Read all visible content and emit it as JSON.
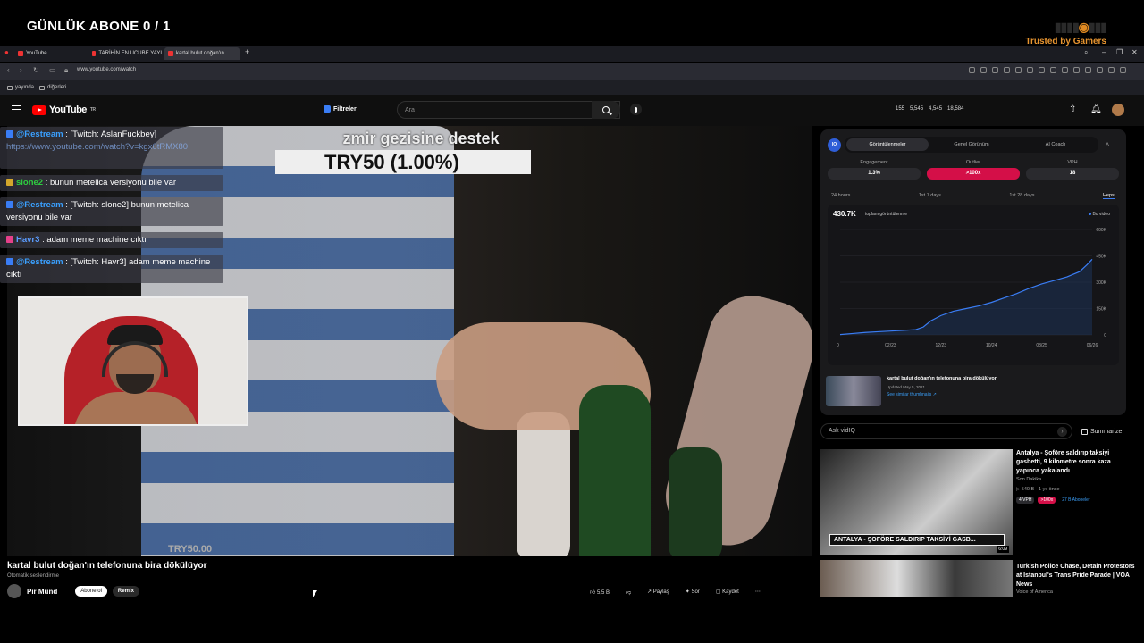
{
  "overlay": {
    "title": "GÜNLÜK ABONE 0 / 1",
    "brand_trust": "Trusted by Gamers"
  },
  "browser": {
    "tabs": [
      {
        "label": "YouTube"
      },
      {
        "label": "TARİHİN EN UCUBE YAYI"
      },
      {
        "label": "kartal bulut doğan'ın"
      }
    ],
    "url": "www.youtube.com/watch",
    "bookmarks": [
      {
        "label": "yayında"
      },
      {
        "label": "diğerleri"
      }
    ]
  },
  "youtube": {
    "logo": "YouTube",
    "logo_region": "TR",
    "filters_label": "Filtreler",
    "search_placeholder": "Ara",
    "stats": [
      "155",
      "5,545",
      "4,545",
      "18,584"
    ]
  },
  "stream": {
    "donation_text": "zmir gezisine destek",
    "donation_amount": "TRY50 (1.00%)",
    "watermark": "TRY50.00"
  },
  "chat": [
    {
      "user": "@Restream",
      "text": ": [Twitch: AslanFuckbey]",
      "extra": "https://www.youtube.com/watch?v=kgx6tRMX80"
    },
    {
      "user": "slone2",
      "text": ": bunun metelica versiyonu bile var"
    },
    {
      "user": "@Restream",
      "text": ": [Twitch: slone2] bunun metelica versiyonu bile var"
    },
    {
      "user": "Havr3",
      "text": ": adam meme machine cıktı"
    },
    {
      "user": "@Restream",
      "text": ": [Twitch: Havr3] adam meme machine cıktı"
    }
  ],
  "video": {
    "title": "kartal bulut doğan'ın telefonuna bira dökülüyor",
    "sub": "Otomatik seslendirme",
    "channel": "Pir Mund",
    "subscribe": "Abone ol",
    "remix": "Remix",
    "actions": [
      "5,5 B",
      "",
      "Paylaş",
      "Sor",
      "Kaydet"
    ]
  },
  "panel": {
    "tabs": [
      "Görüntülenmeler",
      "Genel Görünüm",
      "AI Coach"
    ],
    "metrics": [
      {
        "label": "Engagement",
        "value": "1.3%"
      },
      {
        "label": "Outlier",
        "value": ">100x"
      },
      {
        "label": "VPH",
        "value": "18"
      }
    ],
    "ranges": [
      "24 hours",
      "1st 7 days",
      "1st 28 days",
      "Hepsi"
    ],
    "total_views": "430.7K",
    "views_label": "toplam görüntülenme",
    "legend": "Bu video",
    "related_title": "kartal bulut doğan'ın telefonuna bira dökülüyor",
    "related_date": "Updated May 5, 2021",
    "related_link": "See similar thumbnails ↗"
  },
  "chart_data": {
    "type": "line",
    "x_ticks": [
      "0",
      "02/23",
      "12/23",
      "10/24",
      "08/25",
      "06/26"
    ],
    "y_ticks": [
      "0",
      "150K",
      "300K",
      "450K",
      "600K"
    ],
    "ylim": [
      0,
      600000
    ],
    "series": [
      {
        "name": "Bu video",
        "points": [
          [
            0,
            2000
          ],
          [
            0.05,
            8000
          ],
          [
            0.1,
            14000
          ],
          [
            0.15,
            18000
          ],
          [
            0.2,
            22000
          ],
          [
            0.25,
            26000
          ],
          [
            0.3,
            30000
          ],
          [
            0.33,
            45000
          ],
          [
            0.36,
            80000
          ],
          [
            0.4,
            110000
          ],
          [
            0.45,
            135000
          ],
          [
            0.5,
            150000
          ],
          [
            0.55,
            165000
          ],
          [
            0.6,
            185000
          ],
          [
            0.65,
            210000
          ],
          [
            0.7,
            235000
          ],
          [
            0.75,
            265000
          ],
          [
            0.8,
            290000
          ],
          [
            0.85,
            310000
          ],
          [
            0.9,
            330000
          ],
          [
            0.95,
            360000
          ],
          [
            0.98,
            400000
          ],
          [
            1.0,
            430700
          ]
        ]
      }
    ]
  },
  "ask": {
    "placeholder": "Ask vidIQ",
    "summarize": "Summarize"
  },
  "recommendations": [
    {
      "title": "Antalya - Şoföre saldırıp taksiyi gasbetti, 9 kilometre sonra kaza yapınca yakalandı",
      "channel": "Son Dakika",
      "meta": "540 B · 1 yıl önce",
      "badge_vph": "4 VPH",
      "badge_out": ">100x",
      "badge_sub": "27 B Aboneler",
      "caption": "ANTALYA - ŞOFÖRE SALDIRIP TAKSİYİ GASB...",
      "duration": "6:09"
    },
    {
      "title": "Turkish Police Chase, Detain Protestors at Istanbul's Trans Pride Parade | VOA News",
      "channel": "Voice of America"
    }
  ],
  "colors": {
    "accent": "#3a7df5",
    "outlier": "#d40f48",
    "youtube_red": "#ff0000"
  }
}
